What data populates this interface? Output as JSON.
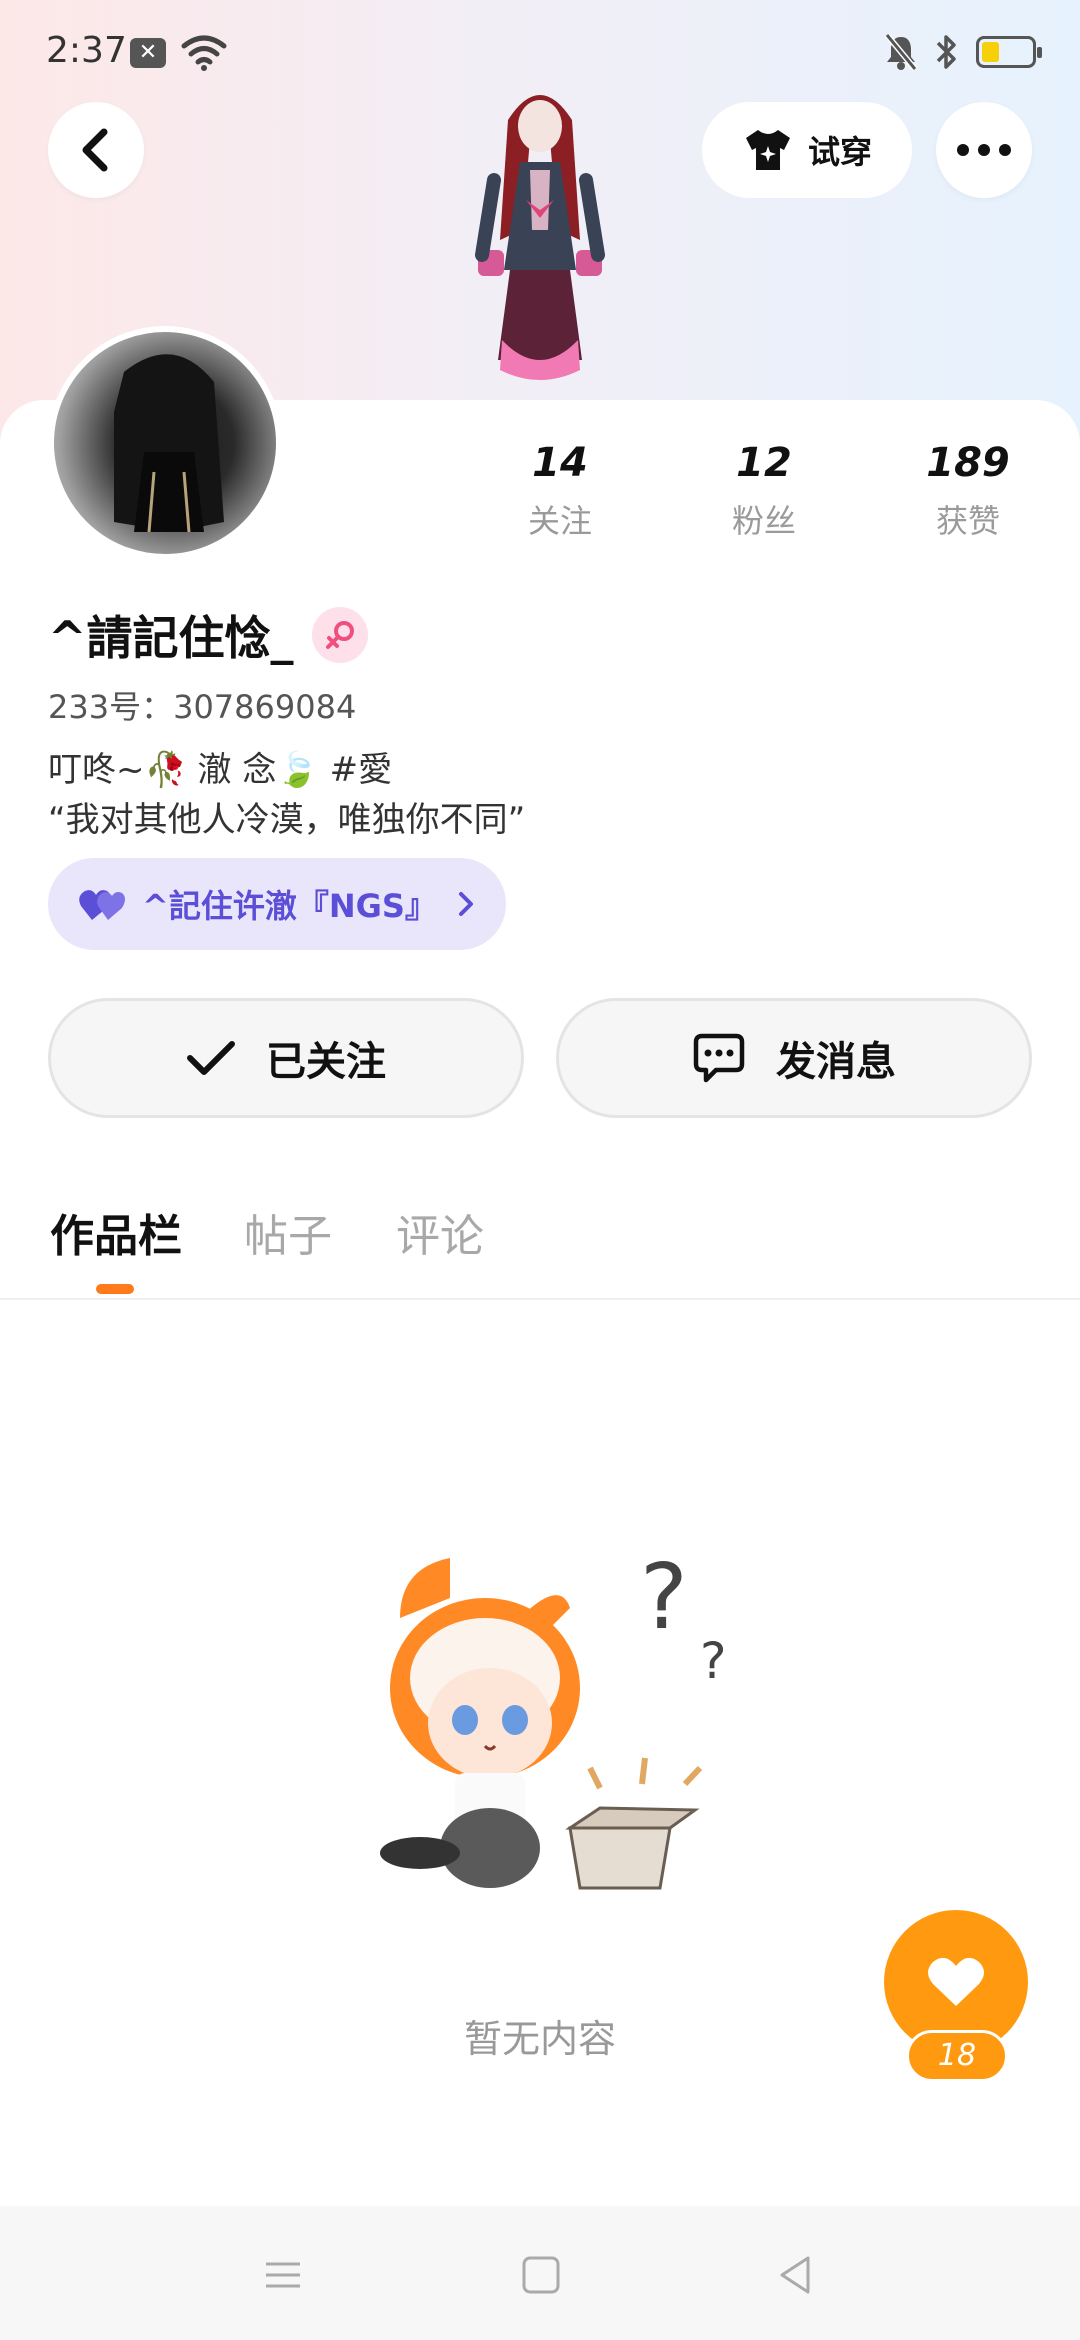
{
  "status_bar": {
    "time": "2:37",
    "battery_level": 0.35,
    "icons": [
      "notification-x-icon",
      "wifi-icon",
      "mute-bell-icon",
      "bluetooth-icon",
      "battery-icon"
    ]
  },
  "header": {
    "tryon_label": "试穿",
    "back_icon": "chevron-left-icon",
    "more_icon": "more-dots-icon"
  },
  "profile": {
    "stats": [
      {
        "value": "14",
        "label": "关注"
      },
      {
        "value": "12",
        "label": "粉丝"
      },
      {
        "value": "189",
        "label": "获赞"
      }
    ],
    "username": "^請記住惗_",
    "gender_icon": "female-icon",
    "uid": "233号：307869084",
    "bio_line1": "叮咚~🥀 澈 念🍃 #愛",
    "bio_line2": "“我对其他人冷漠，唯独你不同”",
    "relation_label": "^記住许澈『NGS』"
  },
  "actions": {
    "follow_label": "已关注",
    "message_label": "发消息"
  },
  "tabs": [
    {
      "label": "作品栏",
      "active": true
    },
    {
      "label": "帖子",
      "active": false
    },
    {
      "label": "评论",
      "active": false
    }
  ],
  "empty_state": {
    "text": "暂无内容"
  },
  "like_fab": {
    "count": "18"
  },
  "colors": {
    "accent": "#ff9a10",
    "tab_indicator": "#ff7a1a",
    "relation_pill_bg": "#e9e6fb",
    "relation_text": "#5a4fd6"
  }
}
